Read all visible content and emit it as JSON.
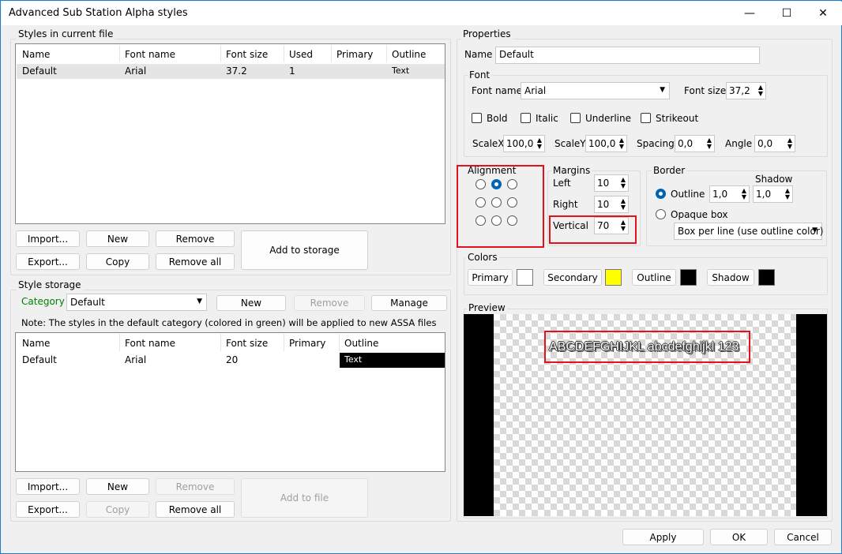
{
  "window": {
    "title": "Advanced Sub Station Alpha styles",
    "minimize": "—",
    "maximize": "☐",
    "close": "✕"
  },
  "current_file": {
    "label": "Styles in current file",
    "columns": [
      "Name",
      "Font name",
      "Font size",
      "Used",
      "Primary",
      "Outline"
    ],
    "rows": [
      {
        "name": "Default",
        "font_name": "Arial",
        "font_size": "37.2",
        "used": "1",
        "primary": "",
        "outline": "Text"
      }
    ],
    "buttons": {
      "import": "Import...",
      "new": "New",
      "remove": "Remove",
      "add_to_storage": "Add to storage",
      "export": "Export...",
      "copy": "Copy",
      "remove_all": "Remove all"
    }
  },
  "storage": {
    "label": "Style storage",
    "category_label": "Category",
    "category_value": "Default",
    "new": "New",
    "remove": "Remove",
    "manage": "Manage",
    "note": "Note: The styles in the default category (colored in green) will be applied to new ASSA files",
    "columns": [
      "Name",
      "Font name",
      "Font size",
      "Primary",
      "Outline"
    ],
    "rows": [
      {
        "name": "Default",
        "font_name": "Arial",
        "font_size": "20",
        "primary": "",
        "outline": "Text"
      }
    ],
    "buttons": {
      "import": "Import...",
      "new": "New",
      "remove": "Remove",
      "add_to_file": "Add to file",
      "export": "Export...",
      "copy": "Copy",
      "remove_all": "Remove all"
    }
  },
  "properties": {
    "label": "Properties",
    "name_label": "Name",
    "name_value": "Default",
    "font": {
      "label": "Font",
      "font_name_label": "Font name",
      "font_name_value": "Arial",
      "font_size_label": "Font size",
      "font_size_value": "37,2",
      "bold": "Bold",
      "italic": "Italic",
      "underline": "Underline",
      "strikeout": "Strikeout",
      "scalex_label": "ScaleX",
      "scalex": "100,0",
      "scaley_label": "ScaleY",
      "scaley": "100,0",
      "spacing_label": "Spacing",
      "spacing": "0,0",
      "angle_label": "Angle",
      "angle": "0,0"
    },
    "alignment": {
      "label": "Alignment",
      "selected": 8
    },
    "margins": {
      "label": "Margins",
      "left_label": "Left",
      "left": "10",
      "right_label": "Right",
      "right": "10",
      "vertical_label": "Vertical",
      "vertical": "70"
    },
    "border": {
      "label": "Border",
      "shadow_label": "Shadow",
      "outline_label": "Outline",
      "outline": "1,0",
      "shadow": "1,0",
      "opaque_label": "Opaque box",
      "box_type": "Box per line (use outline color)"
    },
    "colors": {
      "label": "Colors",
      "primary": "Primary",
      "secondary": "Secondary",
      "outline": "Outline",
      "shadow": "Shadow",
      "primary_color": "#ffffff",
      "secondary_color": "#ffff00",
      "outline_color": "#000000",
      "shadow_color": "#000000"
    },
    "preview": {
      "label": "Preview",
      "text": "ABCDEFGHIJKL abcdefghijkl 123"
    }
  },
  "footer": {
    "apply": "Apply",
    "ok": "OK",
    "cancel": "Cancel"
  },
  "accent": {
    "category_green": "#008000",
    "highlight_red": "#e0121b"
  }
}
